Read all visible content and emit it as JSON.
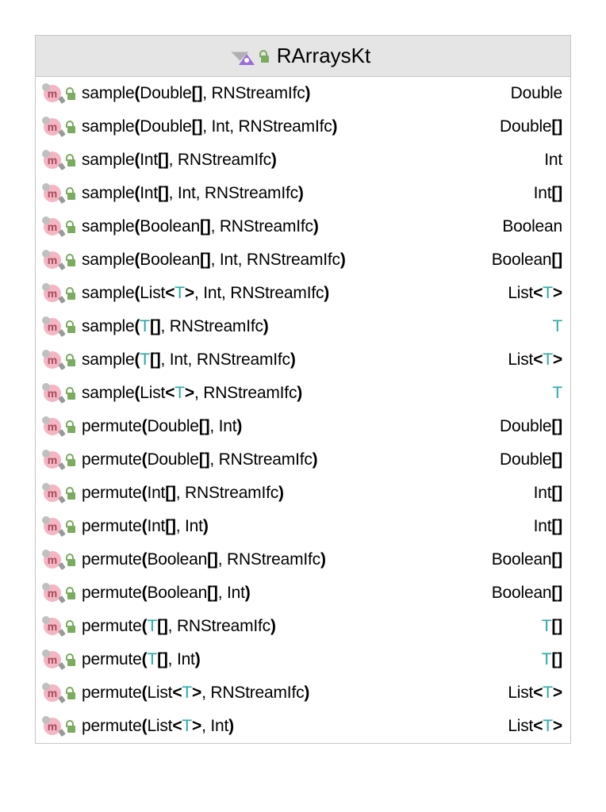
{
  "title": "RArraysKt",
  "methods": [
    {
      "name": "sample",
      "sig": [
        {
          "t": "sample"
        },
        {
          "t": "(",
          "b": true
        },
        {
          "t": "Double"
        },
        {
          "t": "[]",
          "b": true
        },
        {
          "t": ", RNStreamIfc"
        },
        {
          "t": ")",
          "b": true
        }
      ],
      "ret": [
        {
          "t": "Double"
        }
      ]
    },
    {
      "name": "sample",
      "sig": [
        {
          "t": "sample"
        },
        {
          "t": "(",
          "b": true
        },
        {
          "t": "Double"
        },
        {
          "t": "[]",
          "b": true
        },
        {
          "t": ", Int, RNStreamIfc"
        },
        {
          "t": ")",
          "b": true
        }
      ],
      "ret": [
        {
          "t": "Double"
        },
        {
          "t": "[]",
          "b": true
        }
      ]
    },
    {
      "name": "sample",
      "sig": [
        {
          "t": "sample"
        },
        {
          "t": "(",
          "b": true
        },
        {
          "t": "Int"
        },
        {
          "t": "[]",
          "b": true
        },
        {
          "t": ", RNStreamIfc"
        },
        {
          "t": ")",
          "b": true
        }
      ],
      "ret": [
        {
          "t": "Int"
        }
      ]
    },
    {
      "name": "sample",
      "sig": [
        {
          "t": "sample"
        },
        {
          "t": "(",
          "b": true
        },
        {
          "t": "Int"
        },
        {
          "t": "[]",
          "b": true
        },
        {
          "t": ", Int, RNStreamIfc"
        },
        {
          "t": ")",
          "b": true
        }
      ],
      "ret": [
        {
          "t": "Int"
        },
        {
          "t": "[]",
          "b": true
        }
      ]
    },
    {
      "name": "sample",
      "sig": [
        {
          "t": "sample"
        },
        {
          "t": "(",
          "b": true
        },
        {
          "t": "Boolean"
        },
        {
          "t": "[]",
          "b": true
        },
        {
          "t": ", RNStreamIfc"
        },
        {
          "t": ")",
          "b": true
        }
      ],
      "ret": [
        {
          "t": "Boolean"
        }
      ]
    },
    {
      "name": "sample",
      "sig": [
        {
          "t": "sample"
        },
        {
          "t": "(",
          "b": true
        },
        {
          "t": "Boolean"
        },
        {
          "t": "[]",
          "b": true
        },
        {
          "t": ", Int, RNStreamIfc"
        },
        {
          "t": ")",
          "b": true
        }
      ],
      "ret": [
        {
          "t": "Boolean"
        },
        {
          "t": "[]",
          "b": true
        }
      ]
    },
    {
      "name": "sample",
      "sig": [
        {
          "t": "sample"
        },
        {
          "t": "(",
          "b": true
        },
        {
          "t": "List"
        },
        {
          "t": "<",
          "b": true
        },
        {
          "t": "T",
          "g": true
        },
        {
          "t": ">",
          "b": true
        },
        {
          "t": ", Int, RNStreamIfc"
        },
        {
          "t": ")",
          "b": true
        }
      ],
      "ret": [
        {
          "t": "List"
        },
        {
          "t": "<",
          "b": true
        },
        {
          "t": "T",
          "g": true
        },
        {
          "t": ">",
          "b": true
        }
      ]
    },
    {
      "name": "sample",
      "sig": [
        {
          "t": "sample"
        },
        {
          "t": "(",
          "b": true
        },
        {
          "t": "T",
          "g": true
        },
        {
          "t": "[]",
          "b": true
        },
        {
          "t": ", RNStreamIfc"
        },
        {
          "t": ")",
          "b": true
        }
      ],
      "ret": [
        {
          "t": "T",
          "g": true
        }
      ]
    },
    {
      "name": "sample",
      "sig": [
        {
          "t": "sample"
        },
        {
          "t": "(",
          "b": true
        },
        {
          "t": "T",
          "g": true
        },
        {
          "t": "[]",
          "b": true
        },
        {
          "t": ", Int, RNStreamIfc"
        },
        {
          "t": ")",
          "b": true
        }
      ],
      "ret": [
        {
          "t": "List"
        },
        {
          "t": "<",
          "b": true
        },
        {
          "t": "T",
          "g": true
        },
        {
          "t": ">",
          "b": true
        }
      ]
    },
    {
      "name": "sample",
      "sig": [
        {
          "t": "sample"
        },
        {
          "t": "(",
          "b": true
        },
        {
          "t": "List"
        },
        {
          "t": "<",
          "b": true
        },
        {
          "t": "T",
          "g": true
        },
        {
          "t": ">",
          "b": true
        },
        {
          "t": ", RNStreamIfc"
        },
        {
          "t": ")",
          "b": true
        }
      ],
      "ret": [
        {
          "t": "T",
          "g": true
        }
      ]
    },
    {
      "name": "permute",
      "sig": [
        {
          "t": "permute"
        },
        {
          "t": "(",
          "b": true
        },
        {
          "t": "Double"
        },
        {
          "t": "[]",
          "b": true
        },
        {
          "t": ", Int"
        },
        {
          "t": ")",
          "b": true
        }
      ],
      "ret": [
        {
          "t": "Double"
        },
        {
          "t": "[]",
          "b": true
        }
      ]
    },
    {
      "name": "permute",
      "sig": [
        {
          "t": "permute"
        },
        {
          "t": "(",
          "b": true
        },
        {
          "t": "Double"
        },
        {
          "t": "[]",
          "b": true
        },
        {
          "t": ", RNStreamIfc"
        },
        {
          "t": ")",
          "b": true
        }
      ],
      "ret": [
        {
          "t": "Double"
        },
        {
          "t": "[]",
          "b": true
        }
      ]
    },
    {
      "name": "permute",
      "sig": [
        {
          "t": "permute"
        },
        {
          "t": "(",
          "b": true
        },
        {
          "t": "Int"
        },
        {
          "t": "[]",
          "b": true
        },
        {
          "t": ", RNStreamIfc"
        },
        {
          "t": ")",
          "b": true
        }
      ],
      "ret": [
        {
          "t": "Int"
        },
        {
          "t": "[]",
          "b": true
        }
      ]
    },
    {
      "name": "permute",
      "sig": [
        {
          "t": "permute"
        },
        {
          "t": "(",
          "b": true
        },
        {
          "t": "Int"
        },
        {
          "t": "[]",
          "b": true
        },
        {
          "t": ", Int"
        },
        {
          "t": ")",
          "b": true
        }
      ],
      "ret": [
        {
          "t": "Int"
        },
        {
          "t": "[]",
          "b": true
        }
      ]
    },
    {
      "name": "permute",
      "sig": [
        {
          "t": "permute"
        },
        {
          "t": "(",
          "b": true
        },
        {
          "t": "Boolean"
        },
        {
          "t": "[]",
          "b": true
        },
        {
          "t": ", RNStreamIfc"
        },
        {
          "t": ")",
          "b": true
        }
      ],
      "ret": [
        {
          "t": "Boolean"
        },
        {
          "t": "[]",
          "b": true
        }
      ]
    },
    {
      "name": "permute",
      "sig": [
        {
          "t": "permute"
        },
        {
          "t": "(",
          "b": true
        },
        {
          "t": "Boolean"
        },
        {
          "t": "[]",
          "b": true
        },
        {
          "t": ", Int"
        },
        {
          "t": ")",
          "b": true
        }
      ],
      "ret": [
        {
          "t": "Boolean"
        },
        {
          "t": "[]",
          "b": true
        }
      ]
    },
    {
      "name": "permute",
      "sig": [
        {
          "t": "permute"
        },
        {
          "t": "(",
          "b": true
        },
        {
          "t": "T",
          "g": true
        },
        {
          "t": "[]",
          "b": true
        },
        {
          "t": ", RNStreamIfc"
        },
        {
          "t": ")",
          "b": true
        }
      ],
      "ret": [
        {
          "t": "T",
          "g": true
        },
        {
          "t": "[]",
          "b": true
        }
      ]
    },
    {
      "name": "permute",
      "sig": [
        {
          "t": "permute"
        },
        {
          "t": "(",
          "b": true
        },
        {
          "t": "T",
          "g": true
        },
        {
          "t": "[]",
          "b": true
        },
        {
          "t": ", Int"
        },
        {
          "t": ")",
          "b": true
        }
      ],
      "ret": [
        {
          "t": "T",
          "g": true
        },
        {
          "t": "[]",
          "b": true
        }
      ]
    },
    {
      "name": "permute",
      "sig": [
        {
          "t": "permute"
        },
        {
          "t": "(",
          "b": true
        },
        {
          "t": "List"
        },
        {
          "t": "<",
          "b": true
        },
        {
          "t": "T",
          "g": true
        },
        {
          "t": ">",
          "b": true
        },
        {
          "t": ", RNStreamIfc"
        },
        {
          "t": ")",
          "b": true
        }
      ],
      "ret": [
        {
          "t": "List"
        },
        {
          "t": "<",
          "b": true
        },
        {
          "t": "T",
          "g": true
        },
        {
          "t": ">",
          "b": true
        }
      ]
    },
    {
      "name": "permute",
      "sig": [
        {
          "t": "permute"
        },
        {
          "t": "(",
          "b": true
        },
        {
          "t": "List"
        },
        {
          "t": "<",
          "b": true
        },
        {
          "t": "T",
          "g": true
        },
        {
          "t": ">",
          "b": true
        },
        {
          "t": ", Int"
        },
        {
          "t": ")",
          "b": true
        }
      ],
      "ret": [
        {
          "t": "List"
        },
        {
          "t": "<",
          "b": true
        },
        {
          "t": "T",
          "g": true
        },
        {
          "t": ">",
          "b": true
        }
      ]
    }
  ]
}
